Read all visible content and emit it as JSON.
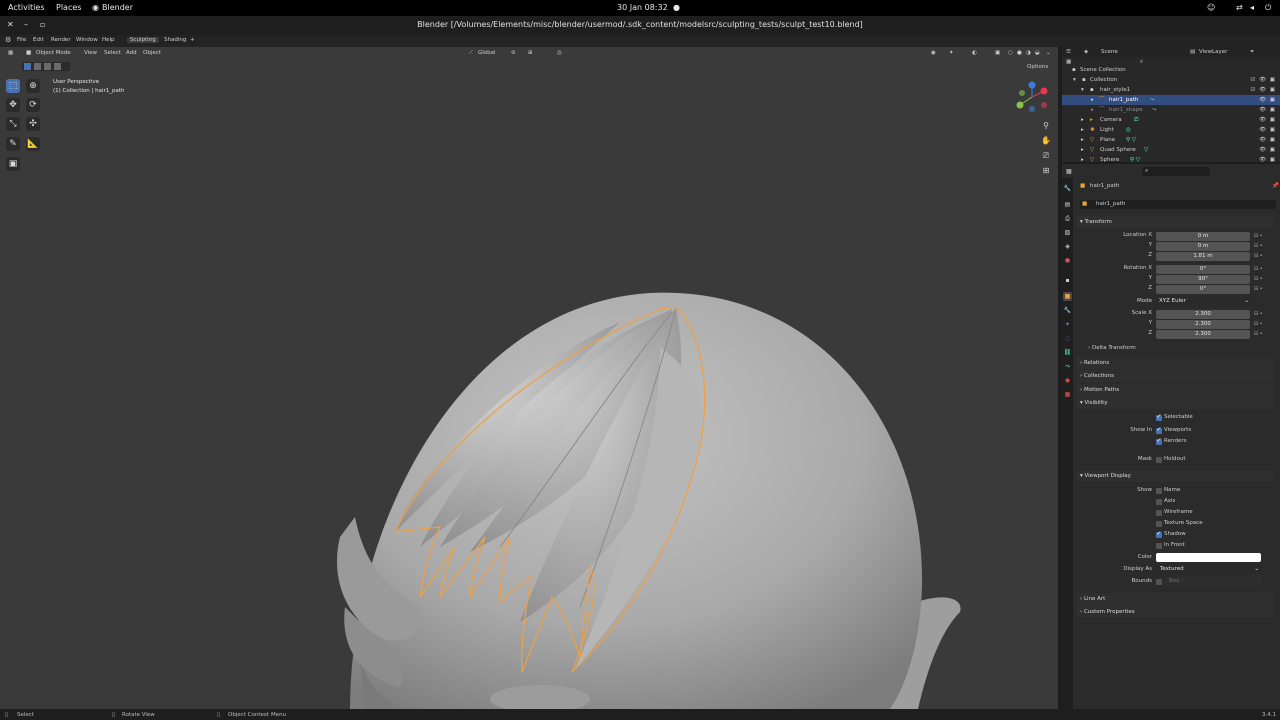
{
  "gnome": {
    "activities": "Activities",
    "places": "Places",
    "app": "Blender",
    "clock": "30 Jan  08:32"
  },
  "window": {
    "title": "Blender [/Volumes/Elements/misc/blender/usermod/.sdk_content/modelsrc/sculpting_tests/sculpt_test10.blend]"
  },
  "menubar": {
    "items": [
      "File",
      "Edit",
      "Render",
      "Window",
      "Help"
    ],
    "workspaces": [
      "Sculpting",
      "Shading"
    ],
    "add_workspace": "+"
  },
  "viewport": {
    "mode": "Object Mode",
    "menus": [
      "View",
      "Select",
      "Add",
      "Object"
    ],
    "orientation": "Global",
    "options": "Options",
    "overlay_title": "User Perspective",
    "overlay_sub": "(1) Collection | hair1_path",
    "colors": {
      "background": "#3a3a3a",
      "selection": "#f0a040",
      "gizmo_x": "#e8364f",
      "gizmo_y": "#8bc34a",
      "gizmo_z": "#3d7de0"
    }
  },
  "outliner": {
    "scene": "Scene",
    "view_layer": "ViewLayer",
    "rows": [
      {
        "label": "Scene Collection"
      },
      {
        "label": "Collection"
      },
      {
        "label": "hair_style1"
      },
      {
        "label": "hair1_path"
      },
      {
        "label": "hair1_shape"
      },
      {
        "label": "Camera"
      },
      {
        "label": "Light"
      },
      {
        "label": "Plane"
      },
      {
        "label": "Quad Sphere"
      },
      {
        "label": "Sphere"
      }
    ]
  },
  "properties": {
    "object_name": "hair1_path",
    "object_field": "hair1_path",
    "transform": {
      "title": "Transform",
      "location_label": "Location X",
      "location": [
        "0 m",
        "0 m",
        "1.81 m"
      ],
      "rotation_label": "Rotation X",
      "rotation": [
        "0°",
        "90°",
        "0°"
      ],
      "mode_label": "Mode",
      "mode": "XYZ Euler",
      "scale_label": "Scale X",
      "scale": [
        "2.300",
        "2.300",
        "2.300"
      ],
      "axis_y": "Y",
      "axis_z": "Z",
      "delta": "Delta Transform"
    },
    "panels": [
      "Relations",
      "Collections",
      "Motion Paths"
    ],
    "visibility": {
      "title": "Visibility",
      "selectable": "Selectable",
      "show_in": "Show In",
      "viewports": "Viewports",
      "renders": "Renders",
      "mask": "Mask",
      "holdout": "Holdout"
    },
    "viewport_display": {
      "title": "Viewport Display",
      "show": "Show",
      "name": "Name",
      "axis": "Axis",
      "wireframe": "Wireframe",
      "texture_space": "Texture Space",
      "shadow": "Shadow",
      "in_front": "In Front",
      "color_label": "Color",
      "display_as_label": "Display As",
      "display_as": "Textured",
      "bounds_label": "Bounds",
      "bounds": "Box"
    },
    "bottom_panels": [
      "Line Art",
      "Custom Properties"
    ]
  },
  "statusbar": {
    "select": "Select",
    "rotate": "Rotate View",
    "context": "Object Context Menu",
    "version": "3.4.1"
  }
}
